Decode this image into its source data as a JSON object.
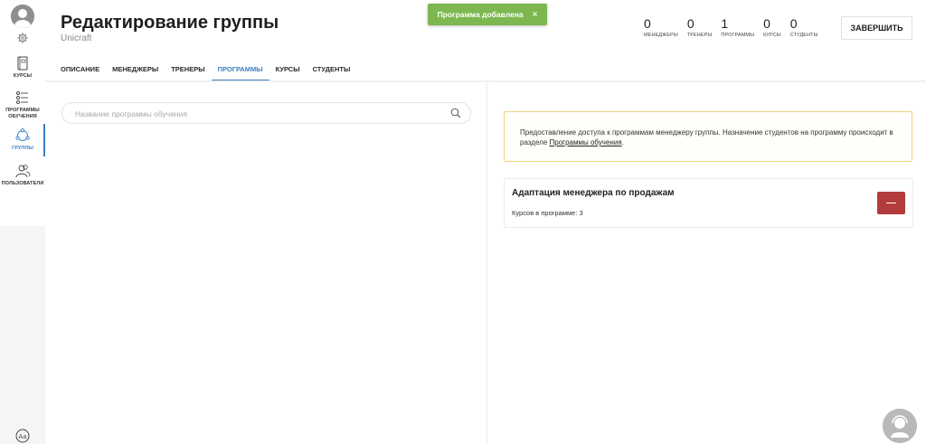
{
  "header": {
    "title": "Редактирование группы",
    "subtitle": "Unicraft",
    "finish_label": "ЗАВЕРШИТЬ"
  },
  "toast": {
    "message": "Программа добавлена",
    "close": "×"
  },
  "stats": [
    {
      "value": "0",
      "label": "менеджеры"
    },
    {
      "value": "0",
      "label": "тренеры"
    },
    {
      "value": "1",
      "label": "программы"
    },
    {
      "value": "0",
      "label": "курсы"
    },
    {
      "value": "0",
      "label": "студенты"
    }
  ],
  "sidebar": {
    "items": [
      {
        "label": "курсы",
        "icon": "book-icon"
      },
      {
        "label": "программы обучения",
        "icon": "list-icon"
      },
      {
        "label": "группы",
        "icon": "groups-icon",
        "active": true
      },
      {
        "label": "пользователи",
        "icon": "users-icon"
      }
    ]
  },
  "tabs": [
    {
      "label": "Описание"
    },
    {
      "label": "Менеджеры"
    },
    {
      "label": "Тренеры"
    },
    {
      "label": "Программы",
      "active": true
    },
    {
      "label": "Курсы"
    },
    {
      "label": "Студенты"
    }
  ],
  "search": {
    "placeholder": "Название программы обучения",
    "value": ""
  },
  "info": {
    "text": "Предоставление доступа к программам менеджеру группы. Назначение студентов на программу происходит в разделе ",
    "link": "Программы обучения",
    "end": "."
  },
  "program": {
    "title": "Адаптация менеджера по продажам",
    "count_text": "Курсов в программе: 3"
  },
  "colors": {
    "accent": "#3b7fc4",
    "toast": "#7cb84f",
    "danger": "#b23b3b",
    "info_border": "#f0d27a"
  }
}
